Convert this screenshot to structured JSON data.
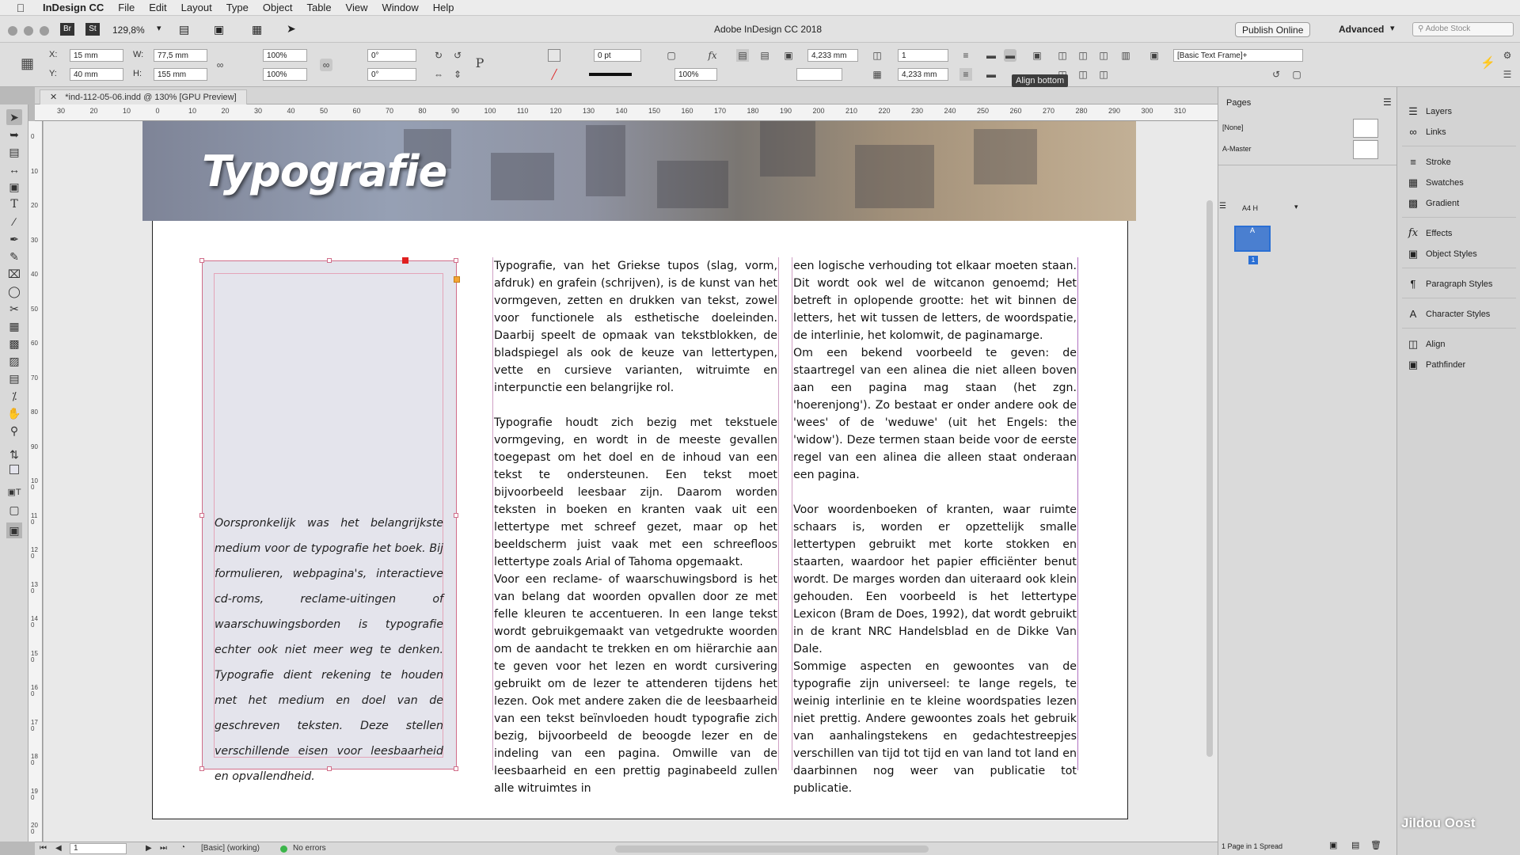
{
  "menubar": {
    "app": "InDesign CC",
    "items": [
      "File",
      "Edit",
      "Layout",
      "Type",
      "Object",
      "Table",
      "View",
      "Window",
      "Help"
    ]
  },
  "titlebar": {
    "bridge": "Br",
    "stock": "St",
    "zoom": "129,8%",
    "title": "Adobe InDesign CC 2018",
    "publish": "Publish Online",
    "workspace": "Advanced",
    "search_placeholder": "Adobe Stock"
  },
  "control": {
    "x_label": "X:",
    "x": "15 mm",
    "y_label": "Y:",
    "y": "40 mm",
    "w_label": "W:",
    "w": "77,5 mm",
    "h_label": "H:",
    "h": "155 mm",
    "scale_x": "100%",
    "scale_y": "100%",
    "rotate": "0°",
    "shear": "0°",
    "stroke_weight": "0 pt",
    "opacity": "100%",
    "gap1": "4,233 mm",
    "gap2": "4,233 mm",
    "columns": "1",
    "frame_style": "[Basic Text Frame]+"
  },
  "tooltip": "Align bottom",
  "document": {
    "tab": "*ind-112-05-06.indd @ 130% [GPU Preview]",
    "ruler": [
      "30",
      "20",
      "10",
      "0",
      "10",
      "20",
      "30",
      "40",
      "50",
      "60",
      "70",
      "80",
      "90",
      "100",
      "110",
      "120",
      "130",
      "140",
      "150",
      "160",
      "170",
      "180",
      "190",
      "200",
      "210",
      "220",
      "230",
      "240",
      "250",
      "260",
      "270",
      "280",
      "290",
      "300",
      "310"
    ],
    "vruler": [
      "0",
      "10",
      "20",
      "30",
      "40",
      "50",
      "60",
      "70",
      "80",
      "90",
      "100",
      "110",
      "120",
      "130",
      "140",
      "150",
      "160",
      "170",
      "180",
      "190",
      "200"
    ],
    "banner_title": "Typografie",
    "sidebar_text": "Oorspronkelijk was het belangrijkste medium voor de typografie het boek. Bij formulieren, webpagina's, interactieve cd-roms, reclame-uitingen of waarschuwingsborden is typografie echter ook niet meer weg te denken. Typografie dient rekening te houden met het medium en doel van de geschreven teksten. Deze stellen verschillende eisen voor leesbaarheid en opvallendheid.",
    "col1": [
      "Typografie, van het Griekse tupos (slag, vorm, afdruk) en grafein (schrijven), is de kunst van het vormgeven, zetten en drukken van tekst, zowel voor functionele als esthetische doeleinden. Daarbij speelt de opmaak van tekstblokken, de bladspiegel als ook de keuze van lettertypen, vette en cursieve varianten, witruimte en interpunctie een belangrijke rol.",
      "Typografie houdt zich bezig met tekstuele vormgeving, en wordt in de meeste gevallen toegepast om het doel en de inhoud van een tekst te ondersteunen. Een tekst moet bijvoorbeeld leesbaar zijn. Daarom worden teksten in boeken en kranten vaak uit een lettertype met schreef gezet, maar op het beeldscherm juist vaak met een schreefloos lettertype zoals Arial of Tahoma opgemaakt.",
      "Voor een reclame- of waarschuwingsbord is het van belang dat woorden opvallen door ze met felle kleuren te accentueren. In een lange tekst wordt gebruikgemaakt van vetgedrukte woorden om de aandacht te trekken en om hiërarchie aan te geven voor het lezen en wordt cursivering gebruikt om de lezer te attenderen tijdens het lezen. Ook met andere zaken die de leesbaarheid van een tekst beïnvloeden houdt typografie zich bezig, bijvoorbeeld de beoogde lezer en de indeling van een pagina. Omwille van de leesbaarheid en een prettig paginabeeld zullen alle witruimtes in"
    ],
    "col2": [
      "een logische verhouding tot elkaar moeten staan. Dit wordt ook wel de witcanon genoemd; Het betreft in oplopende grootte: het wit binnen de letters, het wit tussen de letters, de woordspatie, de interlinie, het kolomwit, de paginamarge.",
      "Om een bekend voorbeeld te geven: de staartregel van een alinea die niet alleen boven aan een pagina mag staan (het zgn. 'hoerenjong'). Zo bestaat er onder andere ook de 'wees' of de 'weduwe' (uit het Engels: the 'widow'). Deze termen staan beide voor de eerste regel van een alinea die alleen staat onderaan een pagina.",
      "Voor woordenboeken of kranten, waar ruimte schaars is, worden er opzettelijk smalle lettertypen gebruikt met korte stokken en staarten, waardoor het papier efficiënter benut wordt. De marges worden dan uiteraard ook klein gehouden. Een voorbeeld is het lettertype Lexicon (Bram de Does, 1992), dat wordt gebruikt in de krant NRC Handelsblad en de Dikke Van Dale.",
      "Sommige aspecten en gewoontes van de typografie zijn universeel: te lange regels, te weinig interlinie en te kleine woordspaties lezen niet prettig. Andere gewoontes zoals het gebruik van aanhalingstekens en gedachtestreepjes verschillen van tijd tot tijd en van land tot land en daarbinnen nog weer van publicatie tot publicatie."
    ]
  },
  "status": {
    "page": "1",
    "profile": "[Basic] (working)",
    "errors": "No errors"
  },
  "pages_panel": {
    "title": "Pages",
    "none": "[None]",
    "master": "A-Master",
    "size": "A4 H",
    "page_num": "1",
    "thumb_label": "A",
    "footer": "1 Page in 1 Spread"
  },
  "dock": {
    "items": [
      "Layers",
      "Links",
      "Stroke",
      "Swatches",
      "Gradient",
      "Effects",
      "Object Styles",
      "Paragraph Styles",
      "Character Styles",
      "Align",
      "Pathfinder"
    ]
  },
  "watermark": "Jildou Oost",
  "colors": {
    "frame_accent": "#d06e8a",
    "selected_page": "#2a6fd4"
  }
}
